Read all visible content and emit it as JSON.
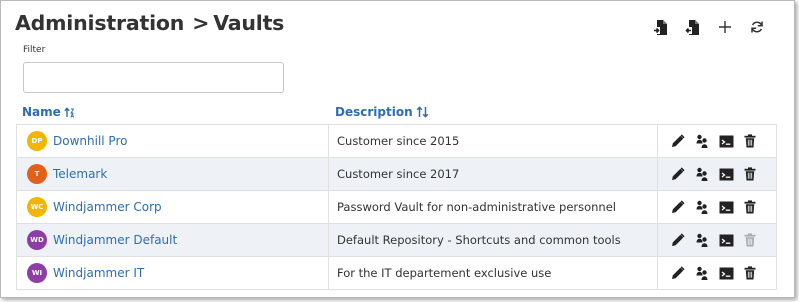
{
  "header": {
    "breadcrumb_root": "Administration",
    "separator": ">",
    "page_title": "Vaults"
  },
  "toolbar": {
    "buttons": [
      {
        "icon": "import-vault-icon"
      },
      {
        "icon": "export-vault-icon"
      },
      {
        "icon": "plus-icon"
      },
      {
        "icon": "refresh-icon"
      }
    ]
  },
  "filter": {
    "label": "Filter",
    "value": "",
    "placeholder": ""
  },
  "columns": {
    "name": "Name",
    "description": "Description"
  },
  "rows": [
    {
      "initials": "DP",
      "name": "Downhill Pro",
      "description": "Customer since 2015",
      "avatar_color": "#f2b600",
      "delete_enabled": true
    },
    {
      "initials": "T",
      "name": "Telemark",
      "description": "Customer since 2017",
      "avatar_color": "#e0601c",
      "delete_enabled": true
    },
    {
      "initials": "WC",
      "name": "Windjammer Corp",
      "description": "Password Vault for non-administrative personnel",
      "avatar_color": "#f2b600",
      "delete_enabled": true
    },
    {
      "initials": "WD",
      "name": "Windjammer Default",
      "description": "Default Repository - Shortcuts and common tools",
      "avatar_color": "#8e3ca6",
      "delete_enabled": false
    },
    {
      "initials": "WI",
      "name": "Windjammer IT",
      "description": "For the IT departement exclusive use",
      "avatar_color": "#8e3ca6",
      "delete_enabled": true
    }
  ],
  "row_actions": [
    "edit-pencil-icon",
    "users-icon",
    "console-icon",
    "trash-icon"
  ],
  "colors": {
    "link": "#2e6db4",
    "alt_row": "#eef2f7",
    "icon": "#222222"
  }
}
